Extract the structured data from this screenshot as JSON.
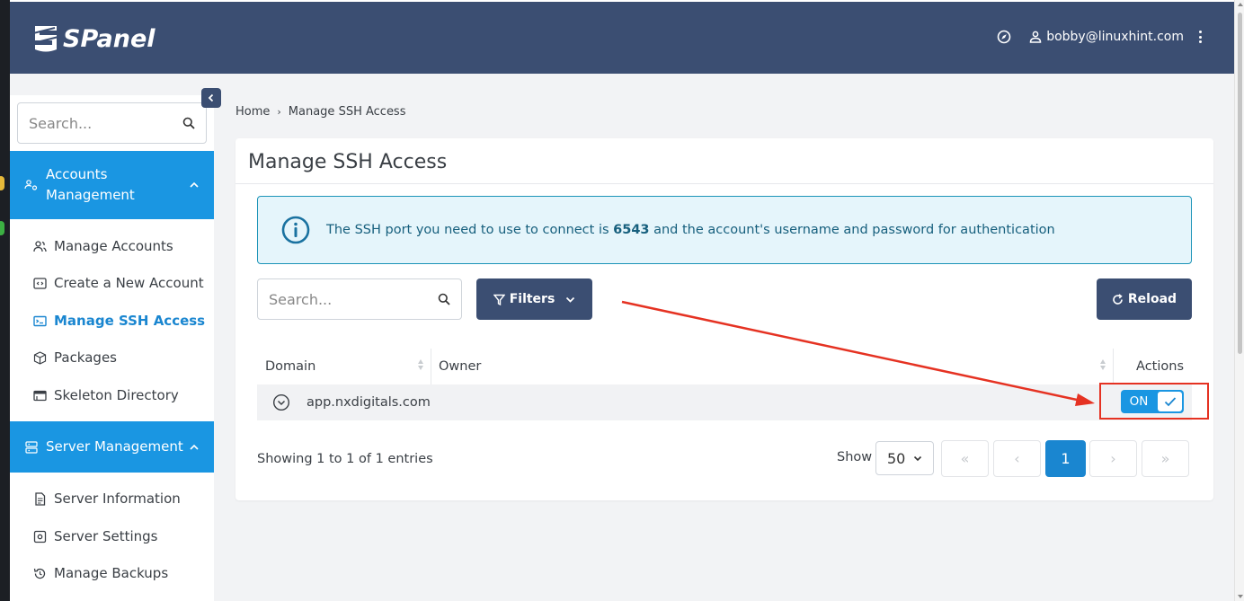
{
  "header": {
    "brand": "SPanel",
    "user_email": "bobby@linuxhint.com"
  },
  "sidebar": {
    "search_placeholder": "Search...",
    "sections": [
      {
        "label": "Accounts Management",
        "items": [
          "Manage Accounts",
          "Create a New Account",
          "Manage SSH Access",
          "Packages",
          "Skeleton Directory"
        ]
      },
      {
        "label": "Server Management",
        "items": [
          "Server Information",
          "Server Settings",
          "Manage Backups"
        ]
      }
    ],
    "active_item": "Manage SSH Access"
  },
  "breadcrumb": {
    "home": "Home",
    "current": "Manage SSH Access"
  },
  "page": {
    "title": "Manage SSH Access",
    "alert": {
      "prefix": "The SSH port you need to use to connect is",
      "port": "6543",
      "suffix": "and the account's username and password for authentication"
    },
    "search_placeholder": "Search...",
    "filters_label": "Filters",
    "reload_label": "Reload"
  },
  "table": {
    "columns": [
      "Domain",
      "Owner",
      "Actions"
    ],
    "rows": [
      {
        "domain": "app.nxdigitals.com",
        "owner": "",
        "toggle_label": "ON",
        "ssh_enabled": true
      }
    ]
  },
  "footer": {
    "entries_text": "Showing 1 to 1 of 1 entries",
    "show_label": "Show",
    "page_size": "50",
    "pagination": {
      "first": "«",
      "prev": "‹",
      "current": "1",
      "next": "›",
      "last": "»"
    }
  },
  "colors": {
    "header_bg": "#3b4e72",
    "accent": "#1a96e2",
    "highlight": "#e53222"
  }
}
